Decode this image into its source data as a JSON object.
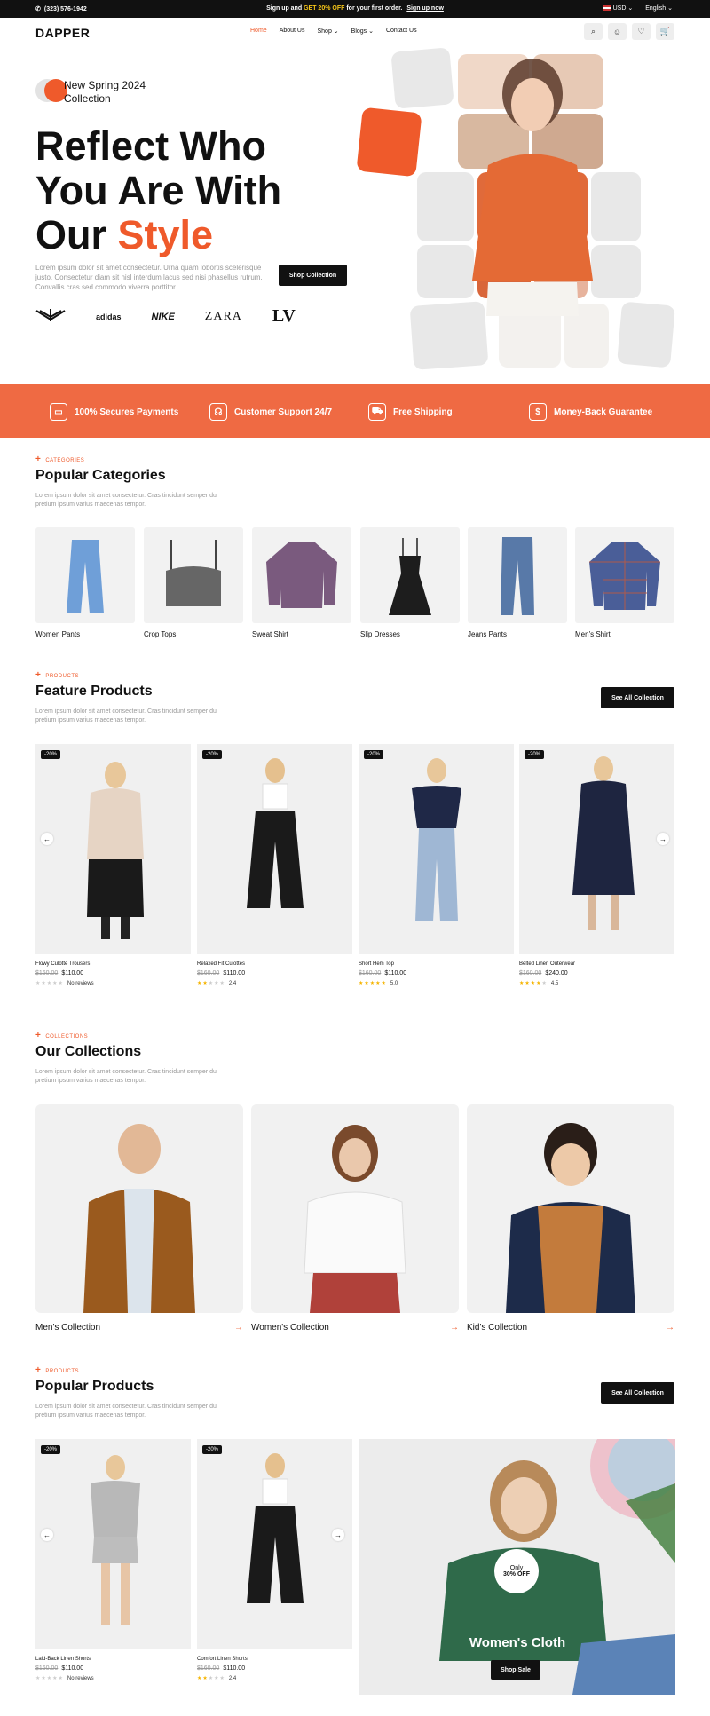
{
  "topbar": {
    "phone": "(323) 576-1942",
    "promo_pre": "Sign up and",
    "promo_hl": "GET 20% OFF",
    "promo_post": "for your first order.",
    "promo_link": "Sign up now",
    "currency": "USD",
    "language": "English"
  },
  "header": {
    "logo": "DAPPER",
    "nav": [
      "Home",
      "About Us",
      "Shop",
      "Blogs",
      "Contact Us"
    ]
  },
  "hero": {
    "tag": "New Spring 2024 Collection",
    "title_l1": "Reflect Who",
    "title_l2": "You Are With",
    "title_l3a": "Our",
    "title_l3b": "Style",
    "desc": "Lorem ipsum dolor sit amet consectetur. Urna quam lobortis scelerisque justo. Consectetur diam sit nisl interdum lacus sed nisi phasellus rutrum. Convallis cras sed commodo viverra porttitor.",
    "button": "Shop Collection",
    "brands": [
      "ARMANI",
      "adidas",
      "NIKE",
      "ZARA",
      "LV"
    ]
  },
  "features": [
    "100% Secures Payments",
    "Customer Support 24/7",
    "Free Shipping",
    "Money-Back Guarantee"
  ],
  "categories": {
    "kicker": "CATEGORIES",
    "title": "Popular Categories",
    "desc": "Lorem ipsum dolor sit amet consectetur. Cras tincidunt semper dui pretium ipsum varius maecenas tempor.",
    "items": [
      "Women Pants",
      "Crop Tops",
      "Sweat Shirt",
      "Slip Dresses",
      "Jeans Pants",
      "Men's Shirt"
    ]
  },
  "featured": {
    "kicker": "PRODUCTS",
    "title": "Feature Products",
    "desc": "Lorem ipsum dolor sit amet consectetur. Cras tincidunt semper dui pretium ipsum varius maecenas tempor.",
    "button": "See All Collection",
    "items": [
      {
        "badge": "-20%",
        "name": "Flowy Culotte Trousers",
        "old": "$160.00",
        "price": "$110.00",
        "rating": "No reviews",
        "stars": 0
      },
      {
        "badge": "-20%",
        "name": "Relaxed Fit Culottes",
        "old": "$160.00",
        "price": "$110.00",
        "rating": "2.4",
        "stars": 2
      },
      {
        "badge": "-20%",
        "name": "Short Hem Top",
        "old": "$160.00",
        "price": "$110.00",
        "rating": "5.0",
        "stars": 5
      },
      {
        "badge": "-20%",
        "name": "Belted Linen Outerwear",
        "old": "$160.00",
        "price": "$240.00",
        "rating": "4.5",
        "stars": 4
      }
    ]
  },
  "collections": {
    "kicker": "COLLECTIONS",
    "title": "Our Collections",
    "desc": "Lorem ipsum dolor sit amet consectetur. Cras tincidunt semper dui pretium ipsum varius maecenas tempor.",
    "items": [
      "Men's Collection",
      "Women's Collection",
      "Kid's Collection"
    ]
  },
  "popular": {
    "kicker": "PRODUCTS",
    "title": "Popular Products",
    "desc": "Lorem ipsum dolor sit amet consectetur. Cras tincidunt semper dui pretium ipsum varius maecenas tempor.",
    "button": "See All Collection",
    "items": [
      {
        "badge": "-20%",
        "name": "Laid-Back Linen Shorts",
        "old": "$160.00",
        "price": "$110.00",
        "rating": "No reviews",
        "stars": 0
      },
      {
        "badge": "-20%",
        "name": "Comfort Linen Shorts",
        "old": "$160.00",
        "price": "$110.00",
        "rating": "2.4",
        "stars": 2
      }
    ],
    "promo": {
      "only": "Only",
      "off": "30% OFF",
      "title": "Women's Cloth",
      "button": "Shop Sale"
    }
  },
  "colors": {
    "accent": "#ef5a2b",
    "dark": "#111111"
  }
}
